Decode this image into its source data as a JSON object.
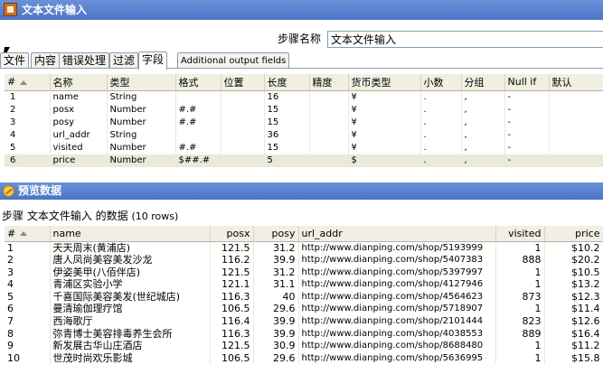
{
  "window": {
    "title": "文本文件输入"
  },
  "step": {
    "label": "步骤名称",
    "value": "文本文件输入"
  },
  "tabs": [
    "文件",
    "内容",
    "错误处理",
    "过滤",
    "字段",
    "Additional output fields"
  ],
  "fields": {
    "columns": [
      "#",
      "名称",
      "类型",
      "格式",
      "位置",
      "长度",
      "精度",
      "货币类型",
      "小数",
      "分组",
      "Null if",
      "默认"
    ],
    "rows": [
      {
        "n": "1",
        "name": "name",
        "type": "String",
        "format": "",
        "position": "",
        "length": "16",
        "precision": "",
        "currency": "¥",
        "decimal": ".",
        "group": ",",
        "nullif": "-",
        "default": ""
      },
      {
        "n": "2",
        "name": "posx",
        "type": "Number",
        "format": "#.#",
        "position": "",
        "length": "15",
        "precision": "",
        "currency": "¥",
        "decimal": ".",
        "group": ",",
        "nullif": "-",
        "default": ""
      },
      {
        "n": "3",
        "name": "posy",
        "type": "Number",
        "format": "#.#",
        "position": "",
        "length": "15",
        "precision": "",
        "currency": "¥",
        "decimal": ".",
        "group": ",",
        "nullif": "-",
        "default": ""
      },
      {
        "n": "4",
        "name": "url_addr",
        "type": "String",
        "format": "",
        "position": "",
        "length": "36",
        "precision": "",
        "currency": "¥",
        "decimal": ".",
        "group": ",",
        "nullif": "-",
        "default": ""
      },
      {
        "n": "5",
        "name": "visited",
        "type": "Number",
        "format": "#.#",
        "position": "",
        "length": "15",
        "precision": "",
        "currency": "¥",
        "decimal": ".",
        "group": ",",
        "nullif": "-",
        "default": ""
      },
      {
        "n": "6",
        "name": "price",
        "type": "Number",
        "format": "$##.#",
        "position": "",
        "length": "5",
        "precision": "",
        "currency": "$",
        "decimal": ".",
        "group": ",",
        "nullif": "-",
        "default": ""
      }
    ]
  },
  "preview": {
    "title": "预览数据",
    "summary": "步骤 文本文件输入 的数据",
    "row_count": "(10 rows)",
    "columns": [
      "#",
      "name",
      "posx",
      "posy",
      "url_addr",
      "visited",
      "price"
    ],
    "rows": [
      {
        "n": "1",
        "name": "天天周末(黄浦店)",
        "posx": "121.5",
        "posy": "31.2",
        "url": "http://www.dianping.com/shop/5193999",
        "visited": "1",
        "price": "$10.2"
      },
      {
        "n": "2",
        "name": "唐人凤尚美容美发沙龙",
        "posx": "116.2",
        "posy": "39.9",
        "url": "http://www.dianping.com/shop/5407383",
        "visited": "888",
        "price": "$20.2"
      },
      {
        "n": "3",
        "name": "伊姿美甲(八佰伴店)",
        "posx": "121.5",
        "posy": "31.2",
        "url": "http://www.dianping.com/shop/5397997",
        "visited": "1",
        "price": "$10.5"
      },
      {
        "n": "4",
        "name": "青浦区实验小学",
        "posx": "121.1",
        "posy": "31.1",
        "url": "http://www.dianping.com/shop/4127946",
        "visited": "1",
        "price": "$13.2"
      },
      {
        "n": "5",
        "name": "千喜国际美容美发(世纪城店)",
        "posx": "116.3",
        "posy": "40",
        "url": "http://www.dianping.com/shop/4564623",
        "visited": "873",
        "price": "$12.3"
      },
      {
        "n": "6",
        "name": "曼清瑜伽理疗馆",
        "posx": "106.5",
        "posy": "29.6",
        "url": "http://www.dianping.com/shop/5718907",
        "visited": "1",
        "price": "$11.4"
      },
      {
        "n": "7",
        "name": "西海歌厅",
        "posx": "116.4",
        "posy": "39.9",
        "url": "http://www.dianping.com/shop/2101444",
        "visited": "823",
        "price": "$12.6"
      },
      {
        "n": "8",
        "name": "弥青博士美容排毒养生会所",
        "posx": "116.3",
        "posy": "39.9",
        "url": "http://www.dianping.com/shop/4038553",
        "visited": "889",
        "price": "$16.4"
      },
      {
        "n": "9",
        "name": "新发展古华山庄酒店",
        "posx": "121.5",
        "posy": "30.9",
        "url": "http://www.dianping.com/shop/8688480",
        "visited": "1",
        "price": "$11.2"
      },
      {
        "n": "10",
        "name": "世茂时尚欢乐影城",
        "posx": "106.5",
        "posy": "29.6",
        "url": "http://www.dianping.com/shop/5636995",
        "visited": "1",
        "price": "$15.8"
      }
    ]
  }
}
